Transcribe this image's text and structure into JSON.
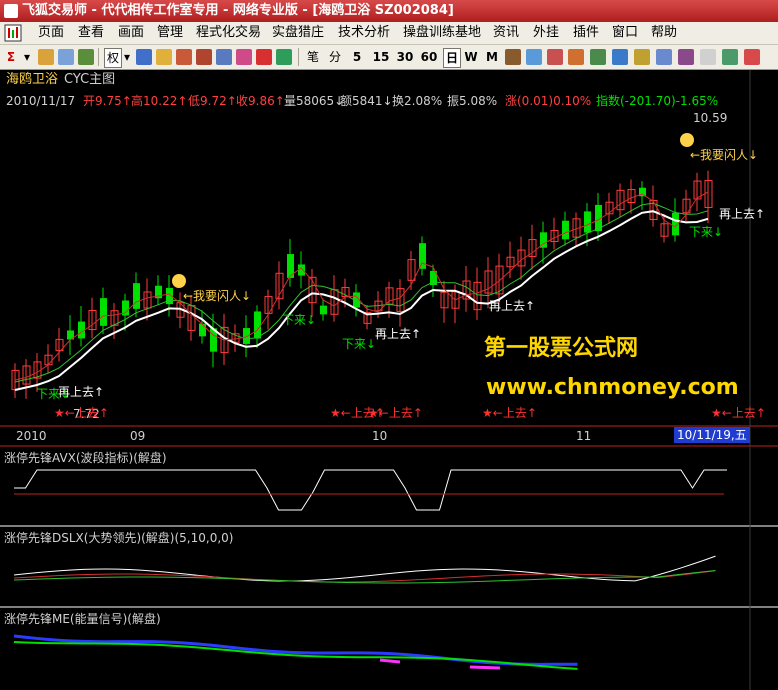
{
  "window": {
    "title": "飞狐交易师 - 代代相传工作室专用 - 网络专业版 - [海鸥卫浴 SZ002084]"
  },
  "menu": [
    "页面",
    "查看",
    "画面",
    "管理",
    "程式化交易",
    "实盘猎庄",
    "技术分析",
    "操盘训练基地",
    "资讯",
    "外挂",
    "插件",
    "窗口",
    "帮助"
  ],
  "toolbar": {
    "rights_label": "权",
    "periods": [
      "笔",
      "分",
      "5",
      "15",
      "30",
      "60",
      "日",
      "W",
      "M"
    ]
  },
  "main_chart": {
    "title_stock": "海鸥卫浴",
    "title_indicator": "CYC主图",
    "date": "2010/11/17",
    "open": "开9.75↑",
    "high": "高10.22↑",
    "low": "低9.72↑",
    "close": "收9.86↑",
    "volume": "量58065↓",
    "amount": "额5841↓",
    "turnover": "换2.08%",
    "amplitude": "振5.08%",
    "change": "涨(0.01)0.10%",
    "index": "指数(-201.70)-1.65%",
    "high_marker": "10.59",
    "low_marker": "7.72",
    "labels": {
      "flash_in": "←我要闪人↓",
      "flash_in_2": "←我要闪人↓",
      "go_again_1": "再上去↑",
      "go_again_2": "再上去↑",
      "go_again_3": "再上去↑",
      "go_again_4": "再上去↑",
      "come_down_1": "下来↓",
      "come_down_2": "下来↓",
      "come_down_3": "下来↓",
      "come_down_4": "下来↓",
      "go_up_1": "★←上去↑",
      "go_up_2": "★←上去↑",
      "go_up_3": "★←上去↑",
      "go_up_4": "★←上去↑",
      "go_up_5": "★←上去↑"
    },
    "watermark_title": "第一股票公式网",
    "watermark_url": "www.chnmoney.com"
  },
  "time_axis": {
    "labels": [
      "2010",
      "09",
      "10",
      "11"
    ],
    "cursor_label": "10/11/19,五"
  },
  "sub1": {
    "title": "涨停先锋AVX(波段指标)(解盘)"
  },
  "sub2": {
    "title": "涨停先锋DSLX(大势领先)(解盘)(5,10,0,0)"
  },
  "sub3": {
    "title": "涨停先锋ME(能量信号)(解盘)"
  },
  "colors": {
    "up": "#ff3b3b",
    "down": "#00e000",
    "ma_white": "#ffffff",
    "label_yellow": "#ffd24a",
    "watermark_blue": "#3fa9f5",
    "cursor_bg": "#1f3ccf"
  }
}
